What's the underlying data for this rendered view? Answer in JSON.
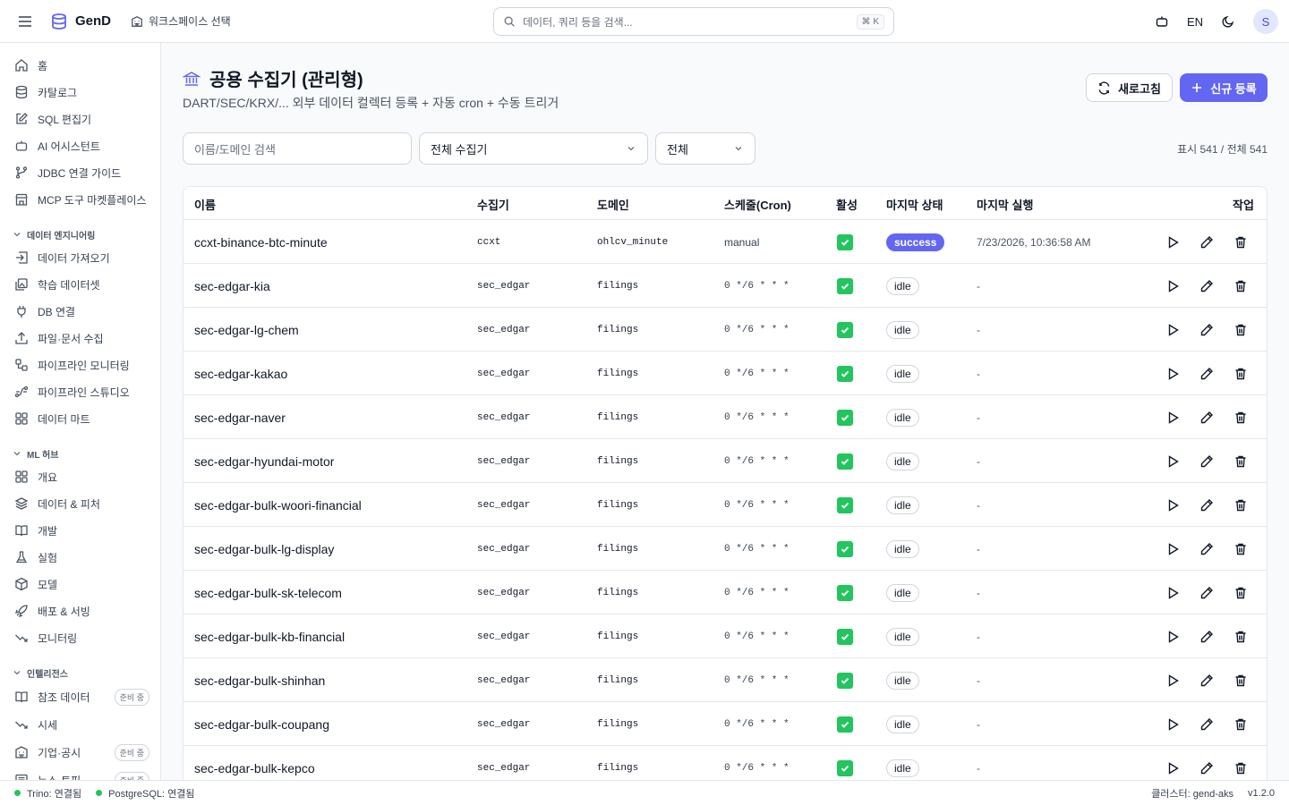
{
  "app": {
    "name": "GenD",
    "workspace": "워크스페이스 선택"
  },
  "search": {
    "placeholder": "데이터, 쿼리 등을 검색...",
    "shortcut": "⌘ K"
  },
  "topbar": {
    "lang": "EN",
    "avatar": "S"
  },
  "sidebar": {
    "top": [
      {
        "label": "홈",
        "icon": "home-icon"
      },
      {
        "label": "카탈로그",
        "icon": "database-icon"
      },
      {
        "label": "SQL 편집기",
        "icon": "edit-icon"
      },
      {
        "label": "AI 어시스턴트",
        "icon": "bot-icon"
      },
      {
        "label": "JDBC 연결 가이드",
        "icon": "branch-icon"
      },
      {
        "label": "MCP 도구 마켓플레이스",
        "icon": "store-icon"
      }
    ],
    "sections": [
      {
        "title": "데이터 엔지니어링",
        "items": [
          {
            "label": "데이터 가져오기",
            "icon": "import-icon"
          },
          {
            "label": "학습 데이터셋",
            "icon": "images-icon"
          },
          {
            "label": "DB 연결",
            "icon": "plug-icon"
          },
          {
            "label": "파일·문서 수집",
            "icon": "upload-icon"
          },
          {
            "label": "파이프라인 모니터링",
            "icon": "workflow-icon"
          },
          {
            "label": "파이프라인 스튜디오",
            "icon": "spline-icon"
          },
          {
            "label": "데이터 마트",
            "icon": "grid-icon"
          }
        ]
      },
      {
        "title": "ML 허브",
        "items": [
          {
            "label": "개요",
            "icon": "grid-icon"
          },
          {
            "label": "데이터 & 피처",
            "icon": "layers-icon"
          },
          {
            "label": "개발",
            "icon": "book-icon"
          },
          {
            "label": "실험",
            "icon": "flask-icon"
          },
          {
            "label": "모델",
            "icon": "box-icon"
          },
          {
            "label": "배포 & 서빙",
            "icon": "rocket-icon"
          },
          {
            "label": "모니터링",
            "icon": "trend-icon"
          }
        ]
      },
      {
        "title": "인텔리전스",
        "items": [
          {
            "label": "참조 데이터",
            "icon": "book-icon",
            "badge": "준비 중"
          },
          {
            "label": "시세",
            "icon": "trend-icon"
          },
          {
            "label": "기업·공시",
            "icon": "building-icon",
            "badge": "준비 중"
          },
          {
            "label": "뉴스·토픽",
            "icon": "news-icon",
            "badge": "준비 중"
          }
        ]
      }
    ]
  },
  "page": {
    "title": "공용 수집기 (관리형)",
    "subtitle": "DART/SEC/KRX/... 외부 데이터 컬렉터 등록 + 자동 cron + 수동 트리거",
    "refresh_label": "새로고침",
    "new_label": "신규 등록",
    "filter_placeholder": "이름/도메인 검색",
    "collector_select": "전체 수집기",
    "status_select": "전체",
    "count": "표시 541 / 전체 541"
  },
  "table": {
    "headers": [
      "이름",
      "수집기",
      "도메인",
      "스케줄(Cron)",
      "활성",
      "마지막 상태",
      "마지막 실행",
      "작업"
    ],
    "rows": [
      {
        "name": "ccxt-binance-btc-minute",
        "collector": "ccxt",
        "domain": "ohlcv_minute",
        "cron": "manual",
        "active": true,
        "status": "success",
        "last_run": "7/23/2026, 10:36:58 AM"
      },
      {
        "name": "sec-edgar-kia",
        "collector": "sec_edgar",
        "domain": "filings",
        "cron": "0 */6 * * *",
        "active": true,
        "status": "idle",
        "last_run": "-"
      },
      {
        "name": "sec-edgar-lg-chem",
        "collector": "sec_edgar",
        "domain": "filings",
        "cron": "0 */6 * * *",
        "active": true,
        "status": "idle",
        "last_run": "-"
      },
      {
        "name": "sec-edgar-kakao",
        "collector": "sec_edgar",
        "domain": "filings",
        "cron": "0 */6 * * *",
        "active": true,
        "status": "idle",
        "last_run": "-"
      },
      {
        "name": "sec-edgar-naver",
        "collector": "sec_edgar",
        "domain": "filings",
        "cron": "0 */6 * * *",
        "active": true,
        "status": "idle",
        "last_run": "-"
      },
      {
        "name": "sec-edgar-hyundai-motor",
        "collector": "sec_edgar",
        "domain": "filings",
        "cron": "0 */6 * * *",
        "active": true,
        "status": "idle",
        "last_run": "-"
      },
      {
        "name": "sec-edgar-bulk-woori-financial",
        "collector": "sec_edgar",
        "domain": "filings",
        "cron": "0 */6 * * *",
        "active": true,
        "status": "idle",
        "last_run": "-"
      },
      {
        "name": "sec-edgar-bulk-lg-display",
        "collector": "sec_edgar",
        "domain": "filings",
        "cron": "0 */6 * * *",
        "active": true,
        "status": "idle",
        "last_run": "-"
      },
      {
        "name": "sec-edgar-bulk-sk-telecom",
        "collector": "sec_edgar",
        "domain": "filings",
        "cron": "0 */6 * * *",
        "active": true,
        "status": "idle",
        "last_run": "-"
      },
      {
        "name": "sec-edgar-bulk-kb-financial",
        "collector": "sec_edgar",
        "domain": "filings",
        "cron": "0 */6 * * *",
        "active": true,
        "status": "idle",
        "last_run": "-"
      },
      {
        "name": "sec-edgar-bulk-shinhan",
        "collector": "sec_edgar",
        "domain": "filings",
        "cron": "0 */6 * * *",
        "active": true,
        "status": "idle",
        "last_run": "-"
      },
      {
        "name": "sec-edgar-bulk-coupang",
        "collector": "sec_edgar",
        "domain": "filings",
        "cron": "0 */6 * * *",
        "active": true,
        "status": "idle",
        "last_run": "-"
      },
      {
        "name": "sec-edgar-bulk-kepco",
        "collector": "sec_edgar",
        "domain": "filings",
        "cron": "0 */6 * * *",
        "active": true,
        "status": "idle",
        "last_run": "-"
      }
    ]
  },
  "statusbar": {
    "trino": "Trino: 연결됨",
    "postgres": "PostgreSQL: 연결됨",
    "cluster": "클러스터: gend-aks",
    "version": "v1.2.0"
  },
  "colors": {
    "accent": "#6366f1",
    "ok": "#22c55e"
  }
}
